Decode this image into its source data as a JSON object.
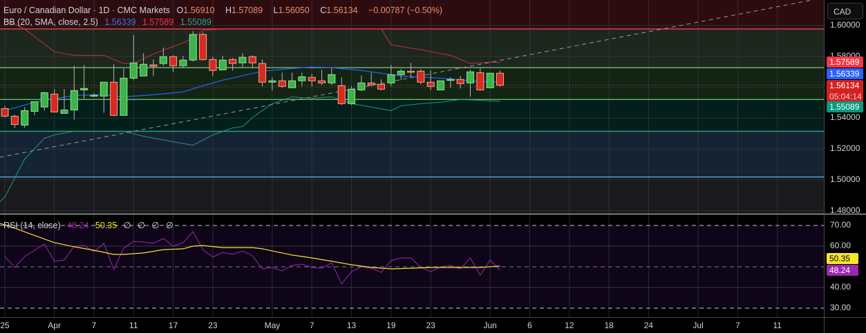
{
  "header": {
    "symbol": "Euro / Canadian Dollar · 1D · CMC Markets",
    "open_label": "O",
    "open": "1.56910",
    "high_label": "H",
    "high": "1.57089",
    "low_label": "L",
    "low": "1.56050",
    "close_label": "C",
    "close": "1.56134",
    "change": "−0.00787 (−0.50%)"
  },
  "bb_legend": {
    "label": "BB (20, SMA, close, 2.5)",
    "basis": "1.56339",
    "upper": "1.57589",
    "lower": "1.55089"
  },
  "rsi_legend": {
    "label": "RSI (14, close)",
    "rsi": "48.24",
    "ma": "50.35",
    "extras": [
      "∅",
      "∅",
      "∅",
      "∅"
    ]
  },
  "currency_button": "CAD",
  "price_axis": {
    "ticks": [
      "1.60000",
      "1.58000",
      "1.56000",
      "1.54000",
      "1.52000",
      "1.50000",
      "1.48000"
    ],
    "tick_values": [
      1.6,
      1.58,
      1.56,
      1.54,
      1.52,
      1.5,
      1.48
    ],
    "badges": {
      "upper": "1.57589",
      "basis": "1.56339",
      "last": "1.56134",
      "countdown": "05:04:14",
      "lower": "1.55089"
    }
  },
  "rsi_axis": {
    "ticks": [
      "70.00",
      "60.00",
      "40.00",
      "30.00"
    ],
    "tick_values": [
      70,
      60,
      40,
      30
    ],
    "badges": {
      "ma": "50.35",
      "rsi": "48.24"
    }
  },
  "x_axis": [
    {
      "label": "25",
      "bar": 0
    },
    {
      "label": "Apr",
      "bar": 5
    },
    {
      "label": "7",
      "bar": 9
    },
    {
      "label": "11",
      "bar": 13
    },
    {
      "label": "17",
      "bar": 17
    },
    {
      "label": "23",
      "bar": 21
    },
    {
      "label": "May",
      "bar": 27
    },
    {
      "label": "7",
      "bar": 31
    },
    {
      "label": "13",
      "bar": 35
    },
    {
      "label": "19",
      "bar": 39
    },
    {
      "label": "23",
      "bar": 43
    },
    {
      "label": "Jun",
      "bar": 49
    },
    {
      "label": "6",
      "bar": 53
    },
    {
      "label": "12",
      "bar": 57
    },
    {
      "label": "18",
      "bar": 61
    },
    {
      "label": "24",
      "bar": 65
    },
    {
      "label": "Jul",
      "bar": 70
    },
    {
      "label": "7",
      "bar": 74
    },
    {
      "label": "11",
      "bar": 78
    }
  ],
  "colors": {
    "up": "#3db34a",
    "down": "#d62a22",
    "basis": "#2962ff",
    "upper": "#f23645",
    "lower": "#22ab94",
    "rsi": "#9c27b0",
    "rsi_ma": "#f5e52e"
  },
  "chart_data": {
    "type": "candlestick",
    "ohlc": [
      [
        1.5462,
        1.548,
        1.5404,
        1.5413
      ],
      [
        1.5413,
        1.5422,
        1.5337,
        1.5359
      ],
      [
        1.5355,
        1.5471,
        1.5337,
        1.5449
      ],
      [
        1.5444,
        1.5507,
        1.5418,
        1.5507
      ],
      [
        1.5472,
        1.557,
        1.5449,
        1.5565
      ],
      [
        1.5556,
        1.5588,
        1.544,
        1.544
      ],
      [
        1.5431,
        1.5588,
        1.5431,
        1.5453
      ],
      [
        1.5453,
        1.574,
        1.5391,
        1.5579
      ],
      [
        1.5583,
        1.5745,
        1.5525,
        1.5592
      ],
      [
        1.5547,
        1.5561,
        1.5538,
        1.5549
      ],
      [
        1.5543,
        1.5633,
        1.5435,
        1.5633
      ],
      [
        1.5633,
        1.5749,
        1.5413,
        1.5418
      ],
      [
        1.5418,
        1.5722,
        1.5418,
        1.5659
      ],
      [
        1.5659,
        1.5937,
        1.5646,
        1.5758
      ],
      [
        1.5673,
        1.5821,
        1.5673,
        1.5749
      ],
      [
        1.5745,
        1.578,
        1.5673,
        1.5736
      ],
      [
        1.5754,
        1.5857,
        1.574,
        1.5798
      ],
      [
        1.5798,
        1.5807,
        1.57,
        1.574
      ],
      [
        1.574,
        1.5803,
        1.5727,
        1.5776
      ],
      [
        1.5776,
        1.5964,
        1.5767,
        1.5942
      ],
      [
        1.5942,
        1.5955,
        1.5772,
        1.578
      ],
      [
        1.578,
        1.5798,
        1.5673,
        1.5709
      ],
      [
        1.5713,
        1.5803,
        1.5709,
        1.5776
      ],
      [
        1.578,
        1.5789,
        1.5709,
        1.5754
      ],
      [
        1.5758,
        1.5821,
        1.5731,
        1.5794
      ],
      [
        1.5798,
        1.5807,
        1.5731,
        1.5758
      ],
      [
        1.5754,
        1.578,
        1.5606,
        1.5633
      ],
      [
        1.5633,
        1.5664,
        1.5579,
        1.5642
      ],
      [
        1.5642,
        1.5695,
        1.5597,
        1.5606
      ],
      [
        1.5597,
        1.5695,
        1.5597,
        1.5642
      ],
      [
        1.5642,
        1.5695,
        1.5606,
        1.5668
      ],
      [
        1.5664,
        1.5686,
        1.5606,
        1.5642
      ],
      [
        1.5642,
        1.5713,
        1.5615,
        1.5628
      ],
      [
        1.5628,
        1.5727,
        1.5615,
        1.5682
      ],
      [
        1.561,
        1.5664,
        1.5485,
        1.5494
      ],
      [
        1.5494,
        1.5606,
        1.5485,
        1.5588
      ],
      [
        1.5583,
        1.5677,
        1.5574,
        1.5628
      ],
      [
        1.5628,
        1.5695,
        1.5606,
        1.5615
      ],
      [
        1.5619,
        1.5651,
        1.5579,
        1.5588
      ],
      [
        1.5628,
        1.5745,
        1.5606,
        1.5682
      ],
      [
        1.5682,
        1.5718,
        1.5646,
        1.5704
      ],
      [
        1.5704,
        1.5758,
        1.5668,
        1.57
      ],
      [
        1.5704,
        1.5718,
        1.5619,
        1.5633
      ],
      [
        1.5633,
        1.5709,
        1.5583,
        1.5606
      ],
      [
        1.5583,
        1.5642,
        1.5583,
        1.5642
      ],
      [
        1.5646,
        1.5664,
        1.5597,
        1.5651
      ],
      [
        1.5651,
        1.5673,
        1.5592,
        1.5624
      ],
      [
        1.5628,
        1.5713,
        1.5538,
        1.57
      ],
      [
        1.5695,
        1.5722,
        1.5579,
        1.5583
      ],
      [
        1.5597,
        1.5691,
        1.5597,
        1.5691
      ],
      [
        1.5691,
        1.5709,
        1.5605,
        1.5613
      ]
    ],
    "bb_upper": [
      [
        0,
        1.604
      ],
      [
        2,
        1.5978
      ],
      [
        5,
        1.583
      ],
      [
        7,
        1.5807
      ],
      [
        10,
        1.5807
      ],
      [
        12,
        1.5754
      ],
      [
        13,
        1.5754
      ],
      [
        15,
        1.5816
      ],
      [
        18,
        1.5888
      ],
      [
        19,
        1.5919
      ],
      [
        20,
        1.5969
      ],
      [
        22,
        1.5978
      ],
      [
        38,
        1.5978
      ],
      [
        39,
        1.5875
      ],
      [
        42,
        1.5843
      ],
      [
        45,
        1.5807
      ],
      [
        47,
        1.5754
      ],
      [
        49,
        1.5763
      ],
      [
        50,
        1.5759
      ]
    ],
    "bb_basis": [
      [
        0,
        1.5449
      ],
      [
        3,
        1.5503
      ],
      [
        7,
        1.5547
      ],
      [
        10,
        1.5552
      ],
      [
        12,
        1.5538
      ],
      [
        15,
        1.5552
      ],
      [
        18,
        1.557
      ],
      [
        20,
        1.561
      ],
      [
        22,
        1.5646
      ],
      [
        26,
        1.5704
      ],
      [
        29,
        1.5722
      ],
      [
        31,
        1.5731
      ],
      [
        33,
        1.5727
      ],
      [
        36,
        1.5709
      ],
      [
        40,
        1.5673
      ],
      [
        44,
        1.5659
      ],
      [
        48,
        1.5637
      ],
      [
        50,
        1.5634
      ]
    ],
    "bb_lower": [
      [
        -0.5,
        1.486
      ],
      [
        0,
        1.4889
      ],
      [
        2,
        1.5135
      ],
      [
        4,
        1.527
      ],
      [
        5,
        1.5292
      ],
      [
        7,
        1.5315
      ],
      [
        12,
        1.5315
      ],
      [
        14,
        1.5283
      ],
      [
        17,
        1.5247
      ],
      [
        19,
        1.5225
      ],
      [
        21,
        1.5292
      ],
      [
        23,
        1.5337
      ],
      [
        24,
        1.5346
      ],
      [
        25,
        1.5404
      ],
      [
        27,
        1.5494
      ],
      [
        29,
        1.5538
      ],
      [
        31,
        1.5529
      ],
      [
        33,
        1.5538
      ],
      [
        35,
        1.5494
      ],
      [
        37,
        1.5472
      ],
      [
        39,
        1.5449
      ],
      [
        40,
        1.548
      ],
      [
        42,
        1.5494
      ],
      [
        44,
        1.5503
      ],
      [
        46,
        1.5521
      ],
      [
        50,
        1.5509
      ]
    ],
    "levels": [
      {
        "price": 1.5978,
        "color": "#e0474f"
      },
      {
        "price": 1.5727,
        "color": "#81c784"
      },
      {
        "price": 1.5521,
        "color": "#66bb6a"
      },
      {
        "price": 1.5315,
        "color": "#26a69a"
      },
      {
        "price": 1.5019,
        "color": "#64b5f6"
      }
    ],
    "zones": [
      {
        "from": 1.62,
        "to": 1.5978,
        "color": "#2d0c10"
      },
      {
        "from": 1.5978,
        "to": 1.5727,
        "color": "#1e271e"
      },
      {
        "from": 1.5727,
        "to": 1.5521,
        "color": "#142414"
      },
      {
        "from": 1.5521,
        "to": 1.5315,
        "color": "#041e1a"
      },
      {
        "from": 1.5315,
        "to": 1.5019,
        "color": "#152433"
      },
      {
        "from": 1.5019,
        "to": 1.47,
        "color": "#1a1a1c"
      }
    ],
    "trendline": [
      [
        -0.5,
        1.5147
      ],
      [
        81.5,
        1.6165
      ]
    ],
    "last_price": 1.56134,
    "ylim": [
      1.47,
      1.6165
    ],
    "rsi": [
      55,
      49.7,
      55,
      58,
      61,
      52.7,
      53.3,
      60,
      60.3,
      57.3,
      61.3,
      48.7,
      59,
      62.3,
      62,
      61.3,
      63.7,
      60,
      61.7,
      67,
      58.3,
      54.7,
      57,
      56,
      57.7,
      55.3,
      49,
      49.7,
      48,
      50.7,
      51.3,
      49.7,
      49.3,
      52,
      41.7,
      47.7,
      50,
      49.3,
      47.3,
      53,
      54.3,
      54.3,
      49.7,
      47.7,
      50,
      50.7,
      49,
      54.3,
      46,
      53.3,
      48.24
    ],
    "rsi_ma": [
      [
        -0.5,
        70.9
      ],
      [
        0,
        70.4
      ],
      [
        5,
        61.7
      ],
      [
        7,
        59.7
      ],
      [
        9,
        58
      ],
      [
        11,
        56
      ],
      [
        12,
        56
      ],
      [
        14,
        56.7
      ],
      [
        16,
        58.3
      ],
      [
        18,
        58.7
      ],
      [
        19,
        60
      ],
      [
        20,
        60.3
      ],
      [
        22,
        59.3
      ],
      [
        25,
        59.3
      ],
      [
        26,
        58.7
      ],
      [
        27,
        57.7
      ],
      [
        29,
        55.7
      ],
      [
        31,
        54.3
      ],
      [
        33,
        52.7
      ],
      [
        35,
        51
      ],
      [
        37,
        49.7
      ],
      [
        39,
        49
      ],
      [
        41,
        49.3
      ],
      [
        43,
        49.7
      ],
      [
        46,
        49.7
      ],
      [
        48,
        49.7
      ],
      [
        50,
        50.35
      ]
    ],
    "rsi_levels": [
      70,
      50,
      30
    ]
  }
}
